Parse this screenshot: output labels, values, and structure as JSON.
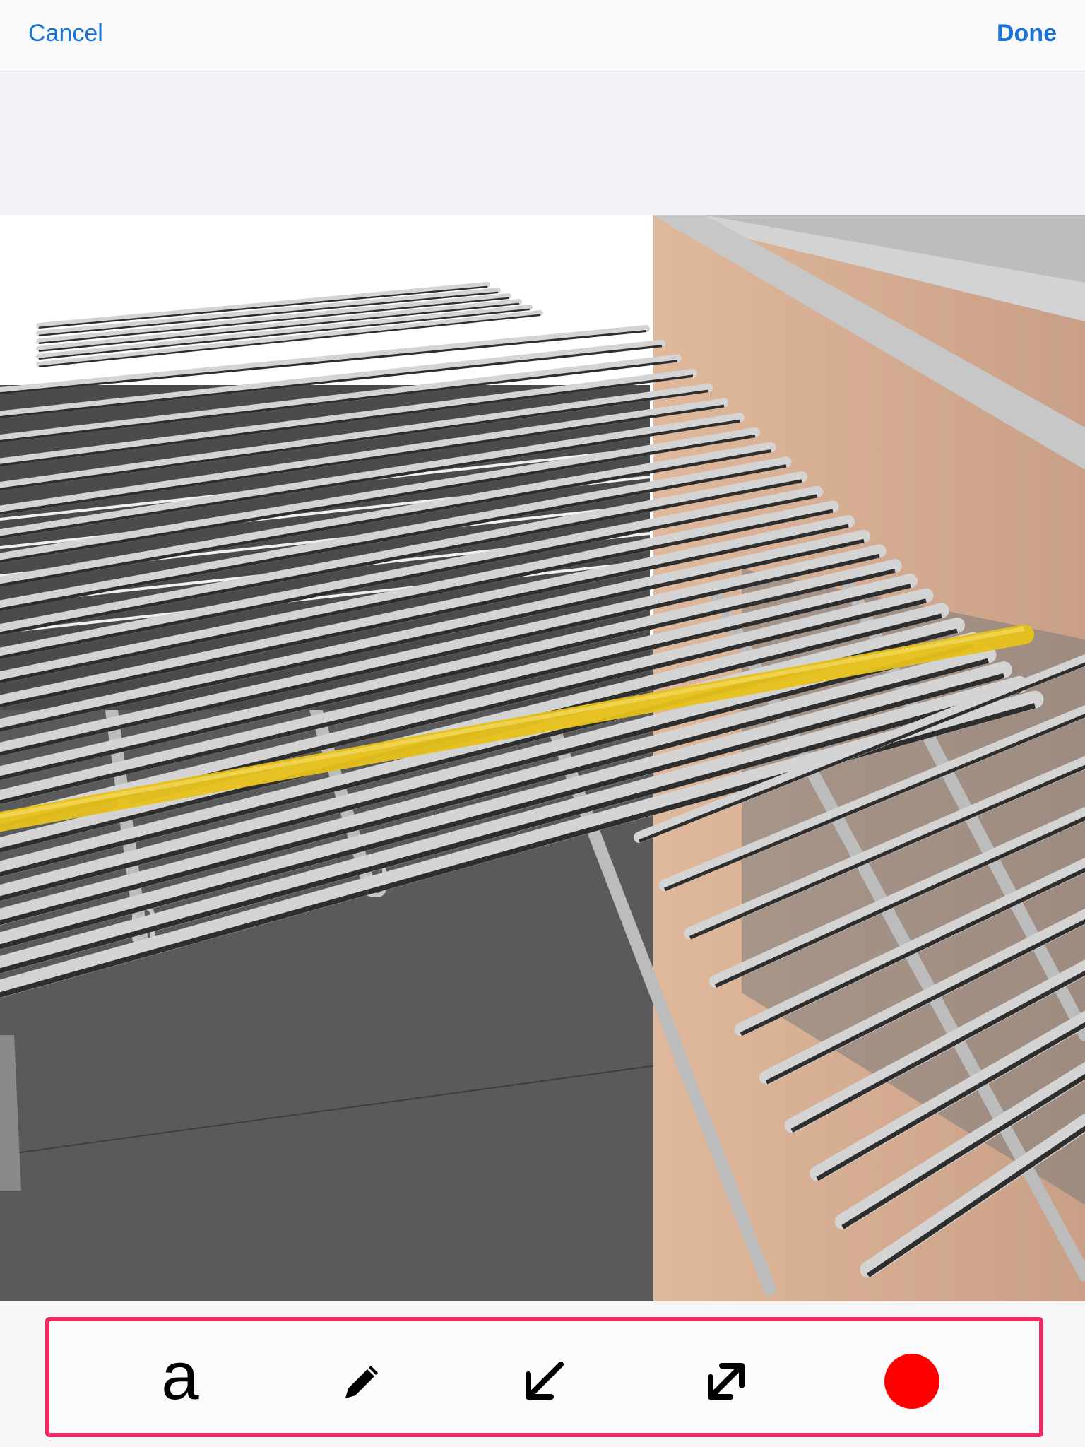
{
  "navbar": {
    "cancel_label": "Cancel",
    "done_label": "Done",
    "accent_color": "#1a73d9"
  },
  "canvas": {
    "description_icon": "bim-3d-rebar-view",
    "highlight_color": "#e7c21c"
  },
  "toolbar": {
    "highlight_border_color": "#ee2a63",
    "tools": [
      {
        "name": "text-tool",
        "glyph": "a"
      },
      {
        "name": "pencil-icon"
      },
      {
        "name": "arrow-icon"
      },
      {
        "name": "double-arrow-icon"
      },
      {
        "name": "color-picker",
        "color": "#ff0000"
      }
    ]
  }
}
